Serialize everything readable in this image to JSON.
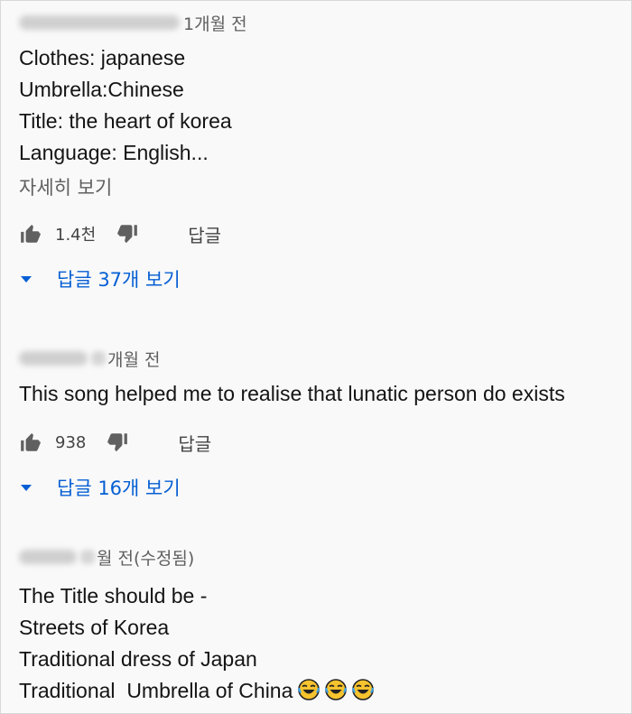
{
  "comments": [
    {
      "time": "1개월 전",
      "lines": [
        "Clothes: japanese",
        "Umbrella:Chinese",
        "Title: the heart of korea",
        "Language: English..."
      ],
      "read_more": "자세히 보기",
      "likes": "1.4천",
      "reply_label": "답글",
      "view_replies": "답글 37개 보기"
    },
    {
      "time": "개월 전",
      "lines": [
        "This song helped me to realise that lunatic person do exists"
      ],
      "likes": "938",
      "reply_label": "답글",
      "view_replies": "답글 16개 보기"
    },
    {
      "time": "월 전(수정됨)",
      "lines": [
        "The Title should be -",
        "Streets of Korea",
        "Traditional dress of Japan",
        "Traditional  Umbrella of China"
      ],
      "emoji_name": "laughing-tears-emoji"
    }
  ],
  "colors": {
    "link_blue": "#065fd4",
    "meta_gray": "#606060",
    "background": "#f9f9f9"
  },
  "icons": {
    "like": "thumbs-up-icon",
    "dislike": "thumbs-down-icon",
    "expand": "caret-down-icon"
  }
}
